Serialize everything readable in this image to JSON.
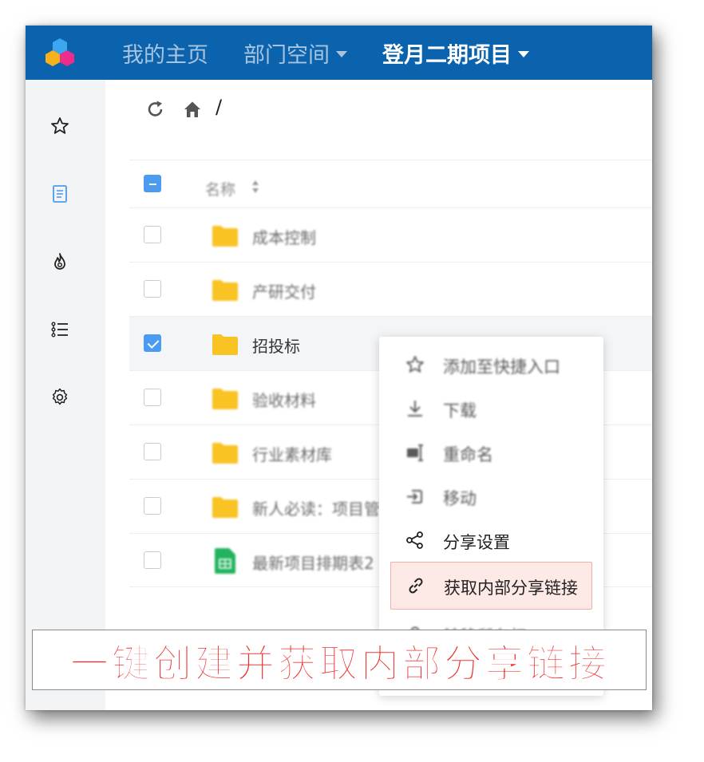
{
  "topbar": {
    "nav": [
      {
        "label": "我的主页",
        "active": false,
        "dropdown": false
      },
      {
        "label": "部门空间",
        "active": false,
        "dropdown": true
      },
      {
        "label": "登月二期项目",
        "active": true,
        "dropdown": true
      }
    ],
    "bg_color": "#0b63ae"
  },
  "sidebar": {
    "icons": [
      "star-icon",
      "document-icon",
      "fire-icon",
      "list-icon",
      "gear-icon"
    ]
  },
  "toolbar": {
    "breadcrumb_separator": "/"
  },
  "table": {
    "header": {
      "name_label": "名称"
    },
    "rows": [
      {
        "name": "成本控制",
        "type": "folder",
        "checked": false
      },
      {
        "name": "产研交付",
        "type": "folder",
        "checked": false
      },
      {
        "name": "招投标",
        "type": "folder",
        "checked": true
      },
      {
        "name": "验收材料",
        "type": "folder",
        "checked": false
      },
      {
        "name": "行业素材库",
        "type": "folder",
        "checked": false
      },
      {
        "name": "新人必读：项目管",
        "type": "folder",
        "checked": false
      },
      {
        "name": "最新项目排期表2",
        "type": "sheet",
        "checked": false
      }
    ]
  },
  "context_menu": {
    "items": [
      {
        "label": "添加至快捷入口",
        "icon": "star-icon"
      },
      {
        "label": "下载",
        "icon": "download-icon"
      },
      {
        "label": "重命名",
        "icon": "rename-icon"
      },
      {
        "label": "移动",
        "icon": "move-icon"
      },
      {
        "label": "分享设置",
        "icon": "share-icon"
      },
      {
        "label": "获取内部分享链接",
        "icon": "link-icon"
      },
      {
        "label": "转移所有权",
        "icon": "user-icon"
      }
    ]
  },
  "caption": {
    "text": "一键创建并获取内部分享链接",
    "color": "#ef2d2d"
  }
}
